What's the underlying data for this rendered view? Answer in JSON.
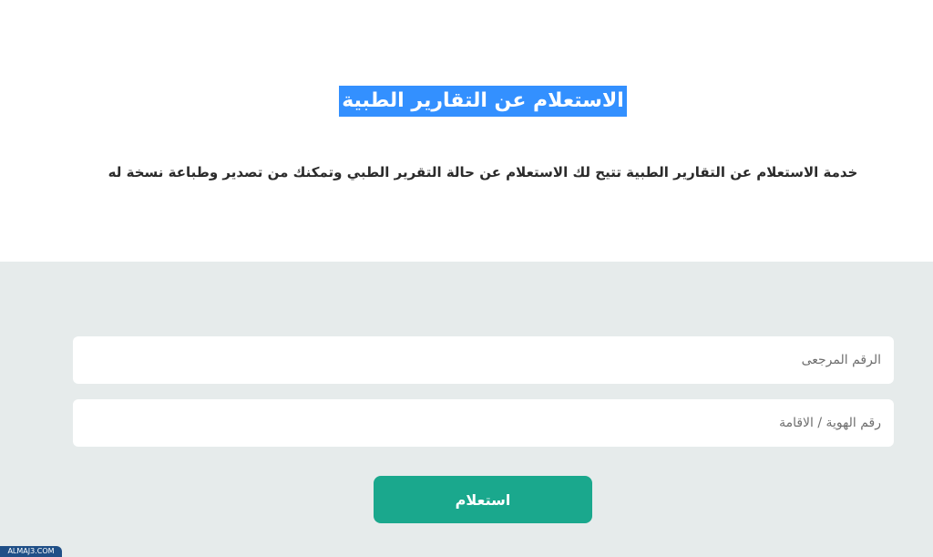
{
  "header": {
    "title": "الاستعلام عن التقارير الطبية",
    "description": "خدمة الاستعلام عن التقارير الطبية تتيح لك الاستعلام عن حالة التقرير الطبي وتمكنك من تصدير وطباعة نسخة له"
  },
  "form": {
    "reference_number": {
      "value": "",
      "placeholder": "الرقم المرجعى"
    },
    "id_number": {
      "value": "",
      "placeholder": "رقم الهوية / الاقامة"
    },
    "submit_label": "استعلام"
  },
  "watermark": {
    "text": "ALMAJ3.COM"
  },
  "colors": {
    "title_highlight": "#3390ff",
    "form_background": "#e6ebeb",
    "button": "#1aa88d",
    "watermark": "#1f4f87"
  }
}
